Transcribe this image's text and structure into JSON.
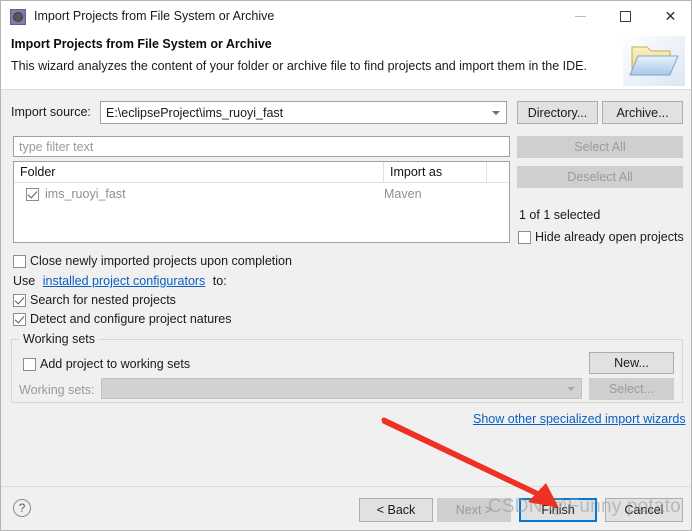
{
  "window": {
    "title": "Import Projects from File System or Archive",
    "icon": "eclipse-icon",
    "minimize_label": "—",
    "maximize_label": "□",
    "close_label": "✕"
  },
  "header": {
    "title": "Import Projects from File System or Archive",
    "description": "This wizard analyzes the content of your folder or archive file to find projects and import them in the IDE.",
    "icon": "folder-icon"
  },
  "form": {
    "import_source_label": "Import source:",
    "import_source_value": "E:\\eclipseProject\\ims_ruoyi_fast",
    "directory_button": "Directory...",
    "archive_button": "Archive...",
    "filter_placeholder": "type filter text",
    "select_all_button": "Select All",
    "deselect_all_button": "Deselect All",
    "selection_status": "1 of 1 selected",
    "hide_open_projects_label": "Hide already open projects",
    "hide_open_projects_checked": false
  },
  "table": {
    "columns": [
      "Folder",
      "Import as"
    ],
    "rows": [
      {
        "checked": true,
        "folder": "ims_ruoyi_fast",
        "import_as": "Maven"
      }
    ]
  },
  "options": {
    "close_projects_label": "Close newly imported projects upon completion",
    "close_projects_checked": false,
    "use_prefix": "Use",
    "configurators_link": "installed project configurators",
    "use_suffix": "to:",
    "search_nested_label": "Search for nested projects",
    "search_nested_checked": true,
    "detect_natures_label": "Detect and configure project natures",
    "detect_natures_checked": true
  },
  "working_sets": {
    "group_title": "Working sets",
    "add_to_working_sets_label": "Add project to working sets",
    "add_to_working_sets_checked": false,
    "working_sets_label": "Working sets:",
    "working_sets_value": "",
    "new_button": "New...",
    "select_button": "Select..."
  },
  "links": {
    "other_wizards": "Show other specialized import wizards"
  },
  "footer": {
    "help_label": "?",
    "back_button": "< Back",
    "next_button": "Next >",
    "finish_button": "Finish",
    "cancel_button": "Cancel"
  },
  "annotation": {
    "watermark": "CSDN @Funny potato",
    "arrow_color": "#ee3124"
  }
}
